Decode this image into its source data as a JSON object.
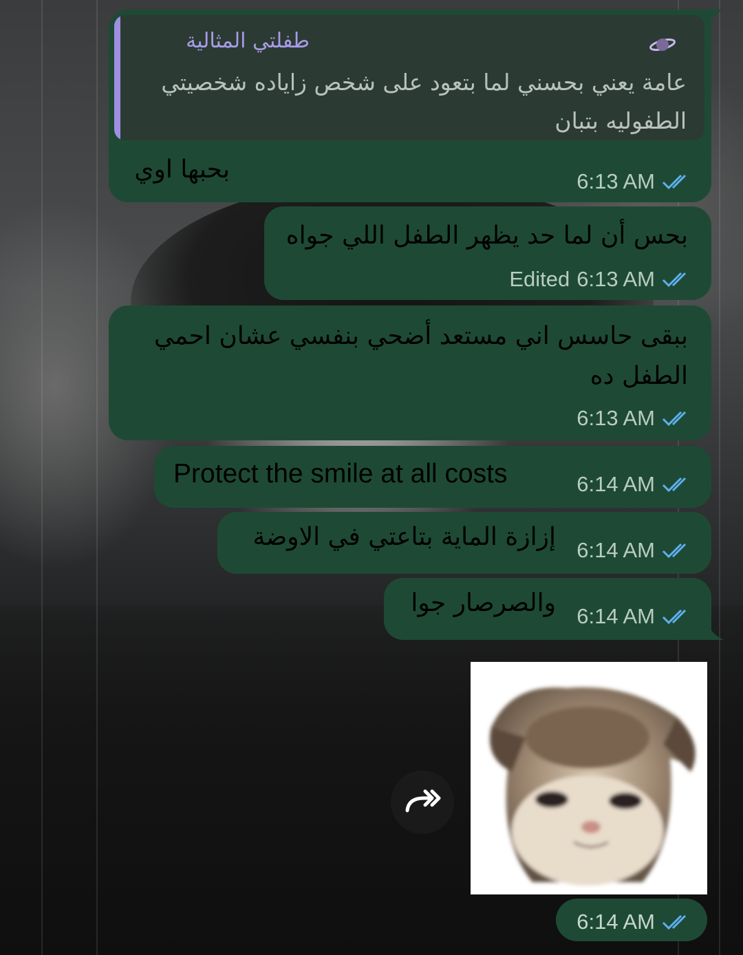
{
  "reply_message": {
    "quoted_sender": "طفلتي المثالية",
    "quoted_sender_icon": "planet-icon",
    "quoted_text": "عامة يعني بحسني لما بتعود على شخص زاياده شخصيتي الطفوليه بتبان",
    "text": "بحبها اوي",
    "time": "6:13 AM"
  },
  "messages": [
    {
      "text": "بحس أن لما حد يظهر الطفل اللي جواه",
      "edited_label": "Edited",
      "time": "6:13 AM"
    },
    {
      "line1": "ببقى حاسس اني مستعد أضحي بنفسي عشان احمي",
      "line2": "الطفل ده",
      "time": "6:13 AM"
    },
    {
      "text": "Protect the smile at all costs",
      "time": "6:14 AM"
    },
    {
      "text": "إزازة الماية بتاعتي في الاوضة",
      "time": "6:14 AM"
    },
    {
      "text": "والصرصار جوا",
      "time": "6:14 AM"
    }
  ],
  "sticker": {
    "time": "6:14 AM",
    "forward_icon": "forward-icon",
    "image": "kitten-sticker"
  },
  "colors": {
    "bubble": "#1e4a35",
    "tick": "#5db0f0",
    "reply_accent": "#9e8fe0"
  }
}
